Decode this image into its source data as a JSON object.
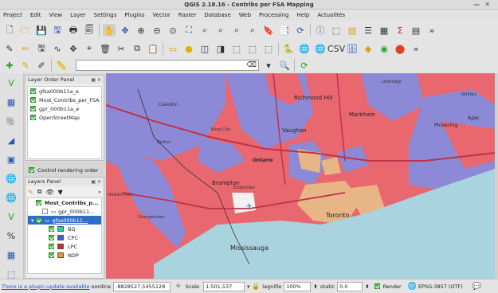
{
  "window": {
    "title": "QGIS 2.18.16 - Contribs per FSA Mapping"
  },
  "menu": [
    "Project",
    "Edit",
    "View",
    "Layer",
    "Settings",
    "Plugins",
    "Vector",
    "Raster",
    "Database",
    "Web",
    "Processing",
    "Help",
    "Actualités"
  ],
  "search": {
    "placeholder": ""
  },
  "layer_order_panel": {
    "title": "Layer Order Panel",
    "items": [
      {
        "label": "gfsa000b11a_e",
        "checked": true
      },
      {
        "label": "Most_Contribs_per_FSA",
        "checked": true
      },
      {
        "label": "gpr_000b11a_e",
        "checked": true
      },
      {
        "label": "OpenStreetMap",
        "checked": true
      }
    ],
    "control_label": "Control rendering order"
  },
  "layers_panel": {
    "title": "Layers Panel",
    "group": "Most_Contribs_p...",
    "sub1": "gpr_000b11...",
    "sub2": "gfsa000b11...",
    "legend": [
      {
        "label": "BQ",
        "color": "#1fd1b4"
      },
      {
        "label": "CPC",
        "color": "#3f5fe0"
      },
      {
        "label": "LPC",
        "color": "#d8242b"
      },
      {
        "label": "NDP",
        "color": "#f39020"
      }
    ]
  },
  "map": {
    "labels": [
      "Caledon",
      "Brampton",
      "Vaughan",
      "Richmond Hill",
      "Markham",
      "Pickering",
      "Ajax",
      "Toronto",
      "Mississauga",
      "Etobicoke",
      "Ontario",
      "King City",
      "Halton Hills",
      "Georgetown",
      "Bolton",
      "Uxbridge",
      "Whitby"
    ],
    "colors": {
      "lpc": "#e9676e",
      "cpc": "#8c8ad6",
      "ndp": "#e8b586",
      "lake": "#a9d3df"
    }
  },
  "status": {
    "plugin_update": "There is a plugin update available",
    "coord_label": "oordina",
    "coordinate": "-8828527,5455128",
    "scale_label": "Scale",
    "scale": "1:501,537",
    "magnifier_label": "lagnifie",
    "magnifier": "100%",
    "rotation_label": "otatic",
    "rotation": "0.0",
    "render_label": "Render",
    "crs": "EPSG:3857 (OTF)"
  }
}
